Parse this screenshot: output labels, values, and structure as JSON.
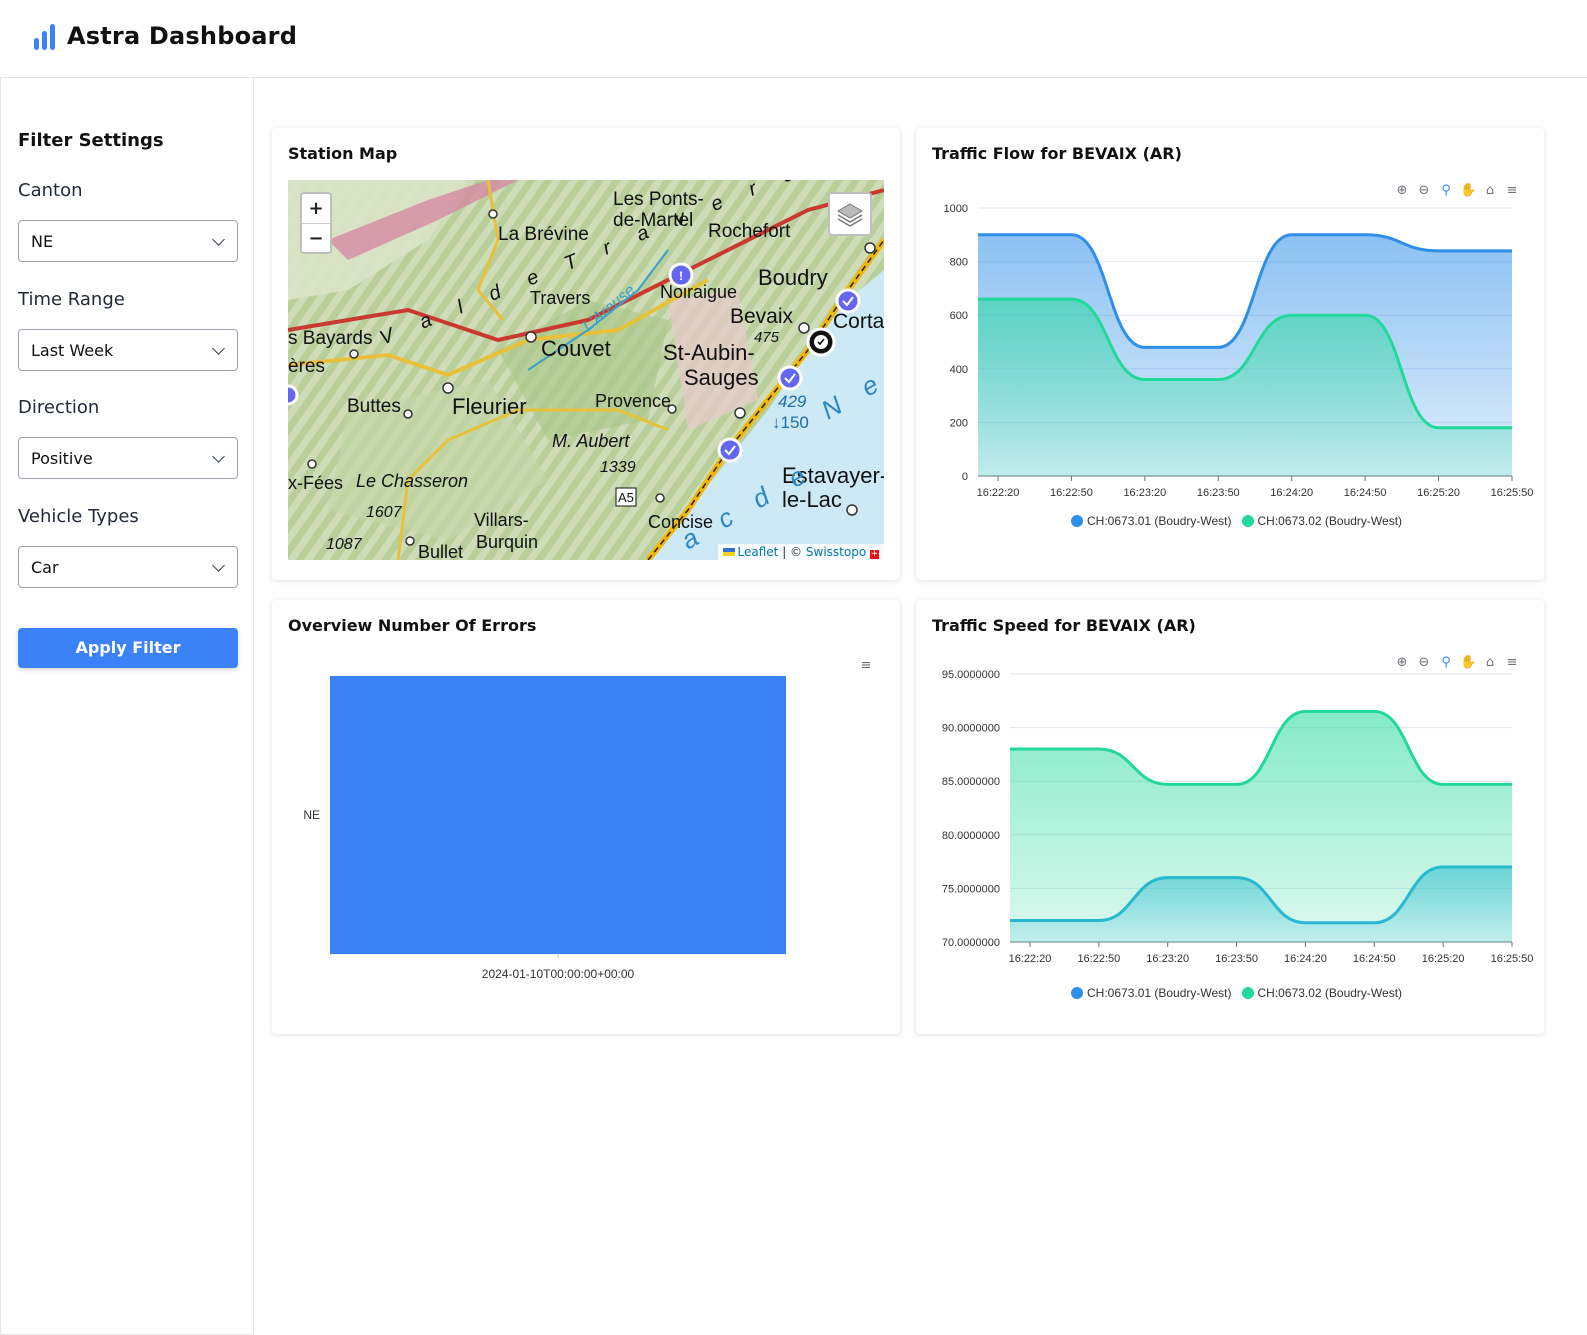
{
  "app": {
    "title": "Astra Dashboard",
    "logo_icon": "bar-chart-icon"
  },
  "sidebar": {
    "title": "Filter Settings",
    "filters": [
      {
        "label": "Canton",
        "value": "NE"
      },
      {
        "label": "Time Range",
        "value": "Last Week"
      },
      {
        "label": "Direction",
        "value": "Positive"
      },
      {
        "label": "Vehicle Types",
        "value": "Car"
      }
    ],
    "apply_label": "Apply Filter"
  },
  "map": {
    "title": "Station Map",
    "zoom_in": "+",
    "zoom_out": "−",
    "attribution": {
      "leaflet": "Leaflet",
      "sep": "| ©",
      "source": "Swisstopo"
    },
    "place_labels": [
      "Les Ponts-",
      "de-Martel",
      "La Brévine",
      "Rochefort",
      "Boudry",
      "Noiraigue",
      "Travers",
      "Bevaix",
      "Cortai",
      "475",
      "s Bayards",
      "ères",
      "Couvet",
      "St-Aubin-",
      "Sauges",
      "Buttes",
      "Fleurier",
      "Provence",
      "429",
      "↓150",
      "M. Aubert",
      "1339",
      "x-Fées",
      "Le Chasseron",
      "1607",
      "Estavayer-",
      "le-Lac",
      "Villars-",
      "Burquin",
      "Concise",
      "1087",
      "Bullet",
      "A5",
      "L'Areuse",
      "V a l  d e  T r a v e r s"
    ]
  },
  "flow_chart": {
    "title": "Traffic Flow for BEVAIX (AR)",
    "chart_data": {
      "type": "area",
      "x": [
        "16:22:20",
        "16:22:50",
        "16:23:20",
        "16:23:50",
        "16:24:20",
        "16:24:50",
        "16:25:20",
        "16:25:50"
      ],
      "ylim": [
        0,
        1000
      ],
      "yticks": [
        "0",
        "200",
        "400",
        "600",
        "800",
        "1000"
      ],
      "series": [
        {
          "name": "CH:0673.01 (Boudry-West)",
          "color": "#2f8fe8",
          "values": [
            900,
            900,
            480,
            480,
            900,
            900,
            840,
            840
          ]
        },
        {
          "name": "CH:0673.02 (Boudry-West)",
          "color": "#21d99a",
          "values": [
            660,
            660,
            360,
            360,
            600,
            600,
            180,
            180
          ]
        }
      ]
    }
  },
  "errors_chart": {
    "title": "Overview Number Of Errors",
    "chart_data": {
      "type": "bar",
      "categories": [
        "2024-01-10T00:00:00+00:00"
      ],
      "series": [
        {
          "name": "NE",
          "values": [
            1
          ]
        }
      ],
      "color": "#3b82f6"
    }
  },
  "speed_chart": {
    "title": "Traffic Speed for BEVAIX (AR)",
    "chart_data": {
      "type": "area",
      "x": [
        "16:22:20",
        "16:22:50",
        "16:23:20",
        "16:23:50",
        "16:24:20",
        "16:24:50",
        "16:25:20",
        "16:25:50"
      ],
      "ylim": [
        70,
        95
      ],
      "yticks": [
        "70.0000000",
        "75.0000000",
        "80.0000000",
        "85.0000000",
        "90.0000000",
        "95.0000000"
      ],
      "series": [
        {
          "name": "CH:0673.01 (Boudry-West)",
          "color": "#29aee0",
          "values": [
            72,
            72,
            76,
            76,
            71.8,
            71.8,
            77,
            77
          ]
        },
        {
          "name": "CH:0673.02 (Boudry-West)",
          "color": "#22d99a",
          "values": [
            88,
            88,
            84.7,
            84.7,
            91.5,
            91.5,
            84.7,
            84.7
          ]
        }
      ]
    }
  },
  "toolbox_icons": [
    "zoom-in-icon",
    "zoom-out-icon",
    "magnify-icon",
    "pan-hand-icon",
    "home-icon",
    "menu-icon"
  ]
}
